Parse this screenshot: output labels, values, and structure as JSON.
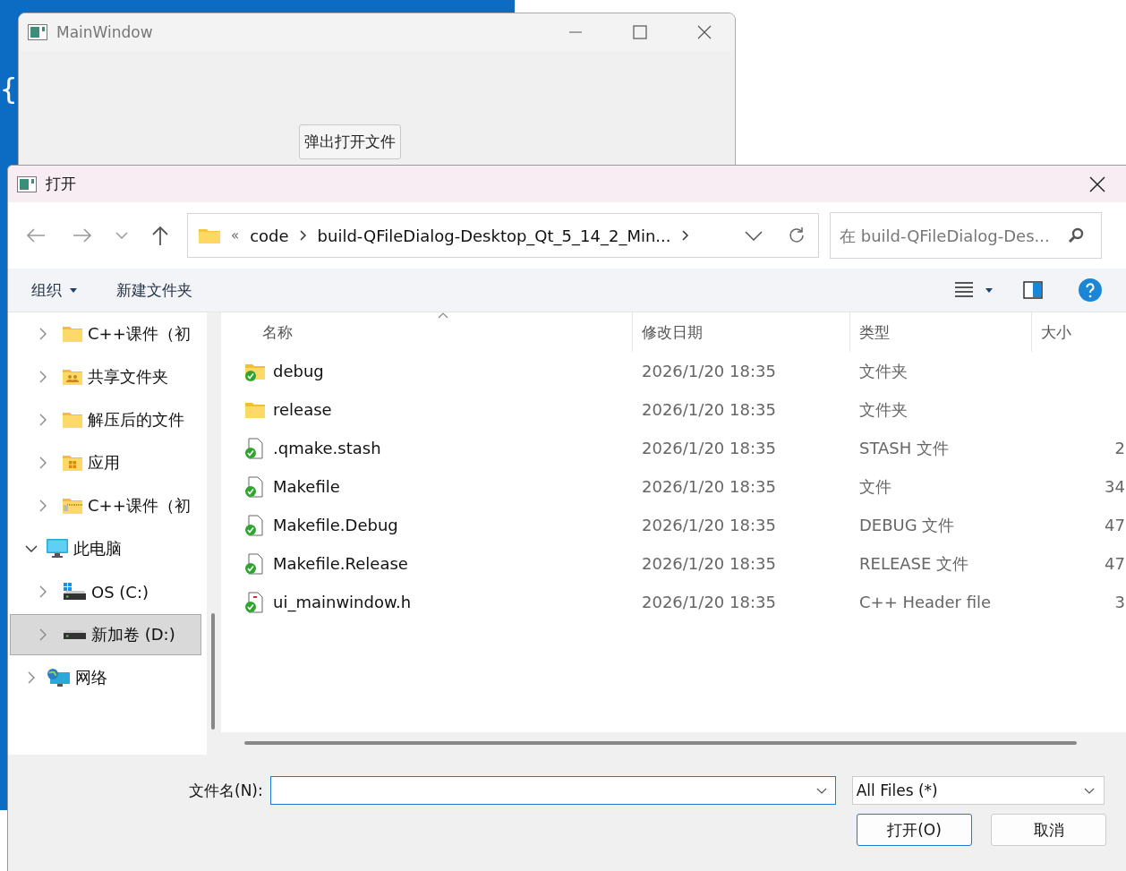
{
  "editor": {
    "code_lines": [
      "{"
    ]
  },
  "main_window": {
    "title": "MainWindow",
    "button": "弹出打开文件"
  },
  "dialog": {
    "title": "打开",
    "address": {
      "overflow": "«",
      "items": [
        "code",
        "build-QFileDialog-Desktop_Qt_5_14_2_Min..."
      ]
    },
    "search": {
      "placeholder": "在 build-QFileDialog-Des..."
    },
    "toolbar": {
      "organize": "组织",
      "new_folder": "新建文件夹"
    },
    "sidebar": {
      "quick_items": [
        {
          "label": "C++课件（初",
          "kind": "folder",
          "expanded": false,
          "selected": false
        },
        {
          "label": "共享文件夹",
          "kind": "shared",
          "expanded": false,
          "selected": false
        },
        {
          "label": "解压后的文件",
          "kind": "folder",
          "expanded": false,
          "selected": false
        },
        {
          "label": "应用",
          "kind": "apps",
          "expanded": false,
          "selected": false
        },
        {
          "label": "C++课件（初",
          "kind": "zip",
          "expanded": false,
          "selected": false
        }
      ],
      "tree": [
        {
          "label": "此电脑",
          "kind": "pc",
          "expanded": true,
          "selected": false,
          "children": [
            {
              "label": "OS (C:)",
              "kind": "system-drive",
              "expanded": false,
              "selected": false
            },
            {
              "label": "新加卷 (D:)",
              "kind": "drive",
              "expanded": false,
              "selected": true
            }
          ]
        },
        {
          "label": "网络",
          "kind": "network",
          "expanded": false,
          "selected": false
        }
      ]
    },
    "table": {
      "columns": [
        "名称",
        "修改日期",
        "类型",
        "大小"
      ],
      "rows": [
        {
          "name": "debug",
          "kind": "folder",
          "synced": true,
          "date": "2026/1/20 18:35",
          "type": "文件夹"
        },
        {
          "name": "release",
          "kind": "folder",
          "synced": false,
          "date": "2026/1/20 18:35",
          "type": "文件夹"
        },
        {
          "name": ".qmake.stash",
          "kind": "file",
          "synced": true,
          "date": "2026/1/20 18:35",
          "type": "STASH 文件",
          "size": "2"
        },
        {
          "name": "Makefile",
          "kind": "file",
          "synced": true,
          "date": "2026/1/20 18:35",
          "type": "文件",
          "size": "34"
        },
        {
          "name": "Makefile.Debug",
          "kind": "file",
          "synced": true,
          "date": "2026/1/20 18:35",
          "type": "DEBUG 文件",
          "size": "47"
        },
        {
          "name": "Makefile.Release",
          "kind": "file",
          "synced": true,
          "date": "2026/1/20 18:35",
          "type": "RELEASE 文件",
          "size": "47"
        },
        {
          "name": "ui_mainwindow.h",
          "kind": "header",
          "synced": true,
          "date": "2026/1/20 18:35",
          "type": "C++ Header file",
          "size": "3"
        }
      ]
    },
    "footer": {
      "filename_label": "文件名(N):",
      "filter": "All Files  (*)",
      "buttons": [
        {
          "label": "打开(O)",
          "default": true
        },
        {
          "label": "取消",
          "default": false
        }
      ]
    }
  }
}
